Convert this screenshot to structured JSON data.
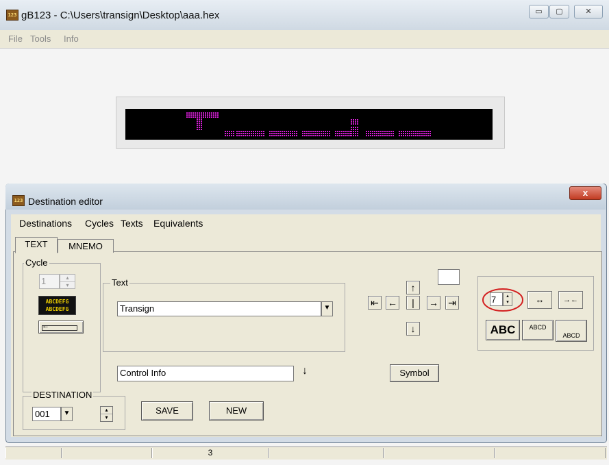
{
  "app": {
    "title": "gB123 - C:\\Users\\transign\\Desktop\\aaa.hex",
    "icon_text": "123",
    "menu": [
      "File",
      "Tools",
      "Info"
    ],
    "status_cells": [
      "",
      "",
      "3",
      "",
      "",
      ""
    ]
  },
  "window_controls": {
    "minimize": "▭",
    "maximize": "▢",
    "close": "✕"
  },
  "dialog": {
    "title": "Destination editor",
    "close": "x",
    "menu": [
      "Destinations",
      "Cycles",
      "Texts",
      "Equivalents"
    ],
    "tabs": [
      "TEXT",
      "MNEMO"
    ],
    "cycle": {
      "label": "Cycle",
      "value": "1",
      "sample_line1": "ABCDEFG",
      "sample_line2": "ABCDEFG"
    },
    "text": {
      "label": "Text",
      "value": "Transign"
    },
    "control_info": {
      "value": "Control Info",
      "arrow": "↓"
    },
    "destination": {
      "label": "DESTINATION",
      "value": "001"
    },
    "buttons": {
      "save": "SAVE",
      "new": "NEW",
      "symbol": "Symbol"
    },
    "nav_arrows": {
      "up": "↑",
      "down": "↓",
      "first": "⇤",
      "left": "←",
      "center": "|",
      "right": "→",
      "last": "⇥"
    },
    "font": {
      "size": "7",
      "expand": "↔",
      "shrink": "→←",
      "bold": "ABC",
      "normal": "ABCD",
      "low": "ABCD"
    }
  },
  "colors": {
    "led_on": "#d51ed5",
    "led_off": "#000000",
    "highlight_ellipse": "#d32020"
  }
}
